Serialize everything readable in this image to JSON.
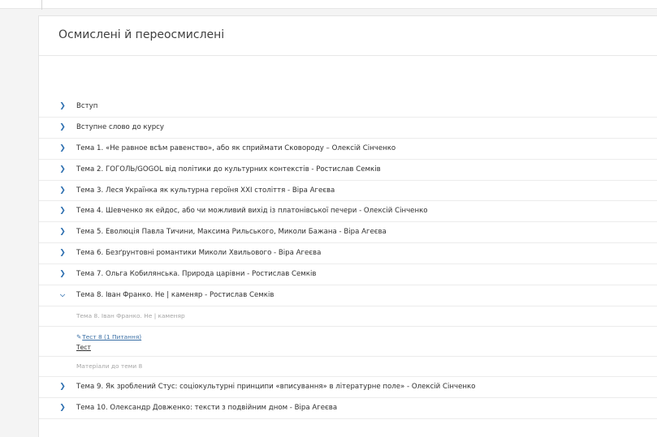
{
  "course": {
    "title": "Осмислені й переосмислені"
  },
  "topics": [
    {
      "label": "Вступ"
    },
    {
      "label": "Вступне слово до курсу"
    },
    {
      "label": "Тема 1. «Не равное всѣм равенство», або як сприймати Сковороду – Олексій Сінченко"
    },
    {
      "label": "Тема 2. ГОГОЛЬ/GOGOL від політики до культурних контекстів - Ростислав Семків"
    },
    {
      "label": "Тема 3. Леся Українка як культурна героїня XXI століття - Віра Агеєва"
    },
    {
      "label": "Тема 4. Шевченко як ейдос, або чи можливий вихід із платонівської печери - Олексій Сінченко"
    },
    {
      "label": "Тема 5. Еволюція Павла Тичини, Максима Рильського, Миколи Бажана - Віра Агеєва"
    },
    {
      "label": "Тема 6. Безґрунтовні романтики Миколи Хвильового - Віра Агеєва"
    },
    {
      "label": "Тема 7. Ольга Кобилянська. Природа царівни - Ростислав Семків"
    },
    {
      "label": "Тема 8. Іван Франко. Не | каменяр - Ростислав Семків"
    },
    {
      "label": "Тема 9. Як зроблений Стус: соціокультурні принципи «вписування» в літературне поле» - Олексій Сінченко"
    },
    {
      "label": "Тема 10. Олександр Довженко: тексти з подвійним дном - Віра Агеєва"
    }
  ],
  "expanded": {
    "section_title": "Тема 8. Іван Франко. Не | каменяр",
    "test_link": "Тест 8 (1 Питання)",
    "test_label": "Тест",
    "materials": "Матеріали до теми 8"
  },
  "icons": {
    "collapsed": "chevron-right-icon",
    "expanded": "chevron-down-icon",
    "edit": "edit-icon"
  },
  "colors": {
    "accent": "#2d6fb0",
    "muted_text": "#a6a6a6"
  }
}
